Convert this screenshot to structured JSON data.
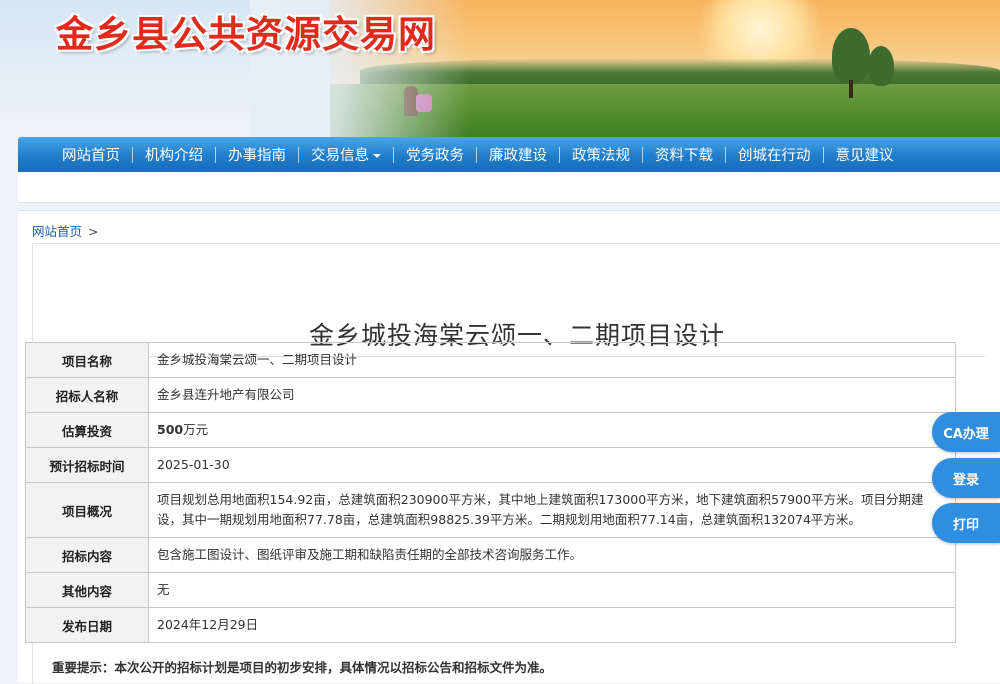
{
  "header": {
    "site_title": "金乡县公共资源交易网"
  },
  "nav": {
    "items": [
      {
        "label": "网站首页"
      },
      {
        "label": "机构介绍"
      },
      {
        "label": "办事指南"
      },
      {
        "label": "交易信息",
        "has_dropdown": true
      },
      {
        "label": "党务政务"
      },
      {
        "label": "廉政建设"
      },
      {
        "label": "政策法规"
      },
      {
        "label": "资料下载"
      },
      {
        "label": "创城在行动"
      },
      {
        "label": "意见建议"
      }
    ]
  },
  "breadcrumb": {
    "home": "网站首页",
    "separator": ">"
  },
  "article": {
    "title": "金乡城投海棠云颂一、二期项目设计",
    "rows": [
      {
        "key": "项目名称",
        "value": "金乡城投海棠云颂一、二期项目设计"
      },
      {
        "key": "招标人名称",
        "value": "金乡县连升地产有限公司"
      },
      {
        "key": "估算投资",
        "value_strong": "500",
        "value_suffix": "万元"
      },
      {
        "key": "预计招标时间",
        "value": "2025-01-30"
      },
      {
        "key": "项目概况",
        "value": "项目规划总用地面积154.92亩，总建筑面积230900平方米，其中地上建筑面积173000平方米，地下建筑面积57900平方米。项目分期建设，其中一期规划用地面积77.78亩，总建筑面积98825.39平方米。二期规划用地面积77.14亩，总建筑面积132074平方米。"
      },
      {
        "key": "招标内容",
        "value": "包含施工图设计、图纸评审及施工期和缺陷责任期的全部技术咨询服务工作。"
      },
      {
        "key": "其他内容",
        "value": "无"
      },
      {
        "key": "发布日期",
        "value": "2024年12月29日"
      }
    ],
    "notice": "重要提示：本次公开的招标计划是项目的初步安排，具体情况以招标公告和招标文件为准。"
  },
  "float_buttons": [
    {
      "label": "CA办理"
    },
    {
      "label": "登录"
    },
    {
      "label": "打印"
    }
  ],
  "colors": {
    "title_red": "#e02a1c",
    "nav_blue": "#1f7ccb",
    "float_blue": "#2f8ee0"
  }
}
